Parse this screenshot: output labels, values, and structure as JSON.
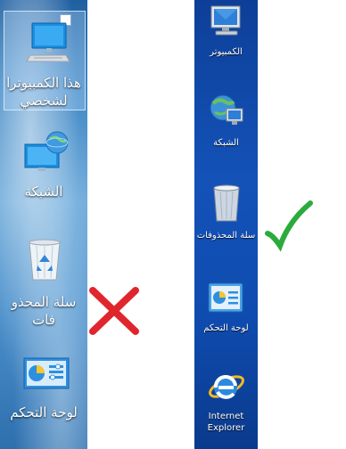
{
  "left_desktop": {
    "icons": [
      {
        "label": "هذا الكمبيوتر الشخصي",
        "line1": "هذا الكمبيوترا",
        "line2": "لشخصي",
        "icon": "monitor-icon"
      },
      {
        "label": "الشبكة",
        "icon": "network-icon"
      },
      {
        "label": "سلة المحذوفات",
        "line1": "سلة المحذو",
        "line2": "فات",
        "icon": "recycle-bin-icon"
      },
      {
        "label": "لوحة التحكم",
        "icon": "control-panel-icon"
      }
    ]
  },
  "right_desktop": {
    "icons": [
      {
        "label": "الكمبيوتر",
        "icon": "computer-icon"
      },
      {
        "label": "الشبكة",
        "icon": "network-icon"
      },
      {
        "label": "سلة المحذوفات",
        "icon": "recycle-bin-icon"
      },
      {
        "label": "لوحة التحكم",
        "icon": "control-panel-icon"
      },
      {
        "label_line1": "Internet",
        "label_line2": "Explorer",
        "icon": "internet-explorer-icon"
      }
    ]
  },
  "marks": {
    "wrong": {
      "icon": "red-x-icon",
      "color": "#e0262d"
    },
    "right": {
      "icon": "green-check-icon",
      "color": "#2bab3c"
    }
  }
}
